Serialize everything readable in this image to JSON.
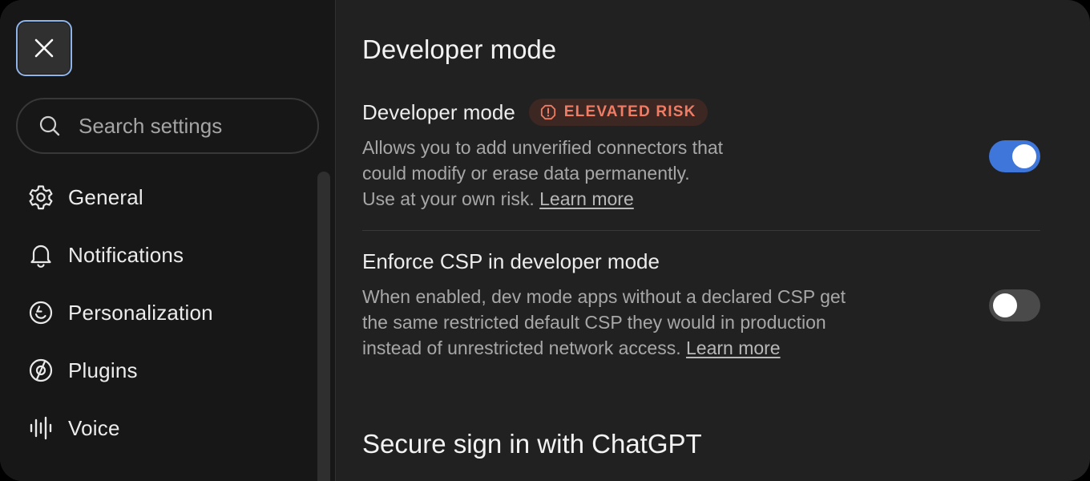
{
  "sidebar": {
    "close_icon": "close-icon",
    "search": {
      "placeholder": "Search settings",
      "value": ""
    },
    "items": [
      {
        "label": "General",
        "icon": "gear-icon"
      },
      {
        "label": "Notifications",
        "icon": "bell-icon"
      },
      {
        "label": "Personalization",
        "icon": "personalization-icon"
      },
      {
        "label": "Plugins",
        "icon": "plugins-icon"
      },
      {
        "label": "Voice",
        "icon": "voice-waveform-icon"
      }
    ]
  },
  "main": {
    "page_title": "Developer mode",
    "settings": [
      {
        "title": "Developer mode",
        "badge": {
          "label": "ELEVATED RISK",
          "icon": "warning-icon",
          "color": "#ef7d66"
        },
        "description_lines": [
          "Allows you to add unverified connectors that",
          "could modify or erase data permanently."
        ],
        "description_last": "Use at your own risk.",
        "link": "Learn more",
        "enabled": true
      },
      {
        "title": "Enforce CSP in developer mode",
        "description_lines": [
          "When enabled, dev mode apps without a declared CSP get",
          "the same restricted default CSP they would in production"
        ],
        "description_last": "instead of unrestricted network access.",
        "link": "Learn more",
        "enabled": false
      }
    ],
    "next_section_title": "Secure sign in with ChatGPT"
  },
  "colors": {
    "accent": "#3e76d9",
    "focus_ring": "#8fb4ea",
    "danger": "#ef7d66"
  }
}
